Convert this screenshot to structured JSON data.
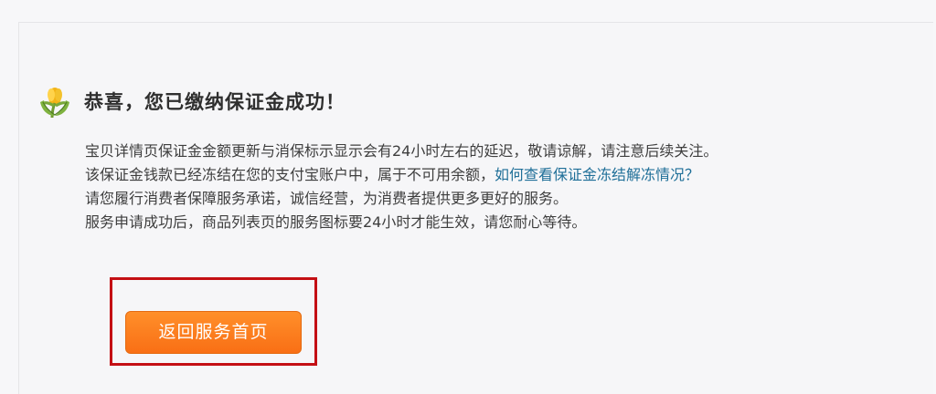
{
  "success": {
    "title": "恭喜，您已缴纳保证金成功！",
    "lines": {
      "line1": "宝贝详情页保证金金额更新与消保标示显示会有24小时左右的延迟，敬请谅解，请注意后续关注。",
      "line2_prefix": "该保证金钱款已经冻结在您的支付宝账户中，属于不可用余额，",
      "line2_link": "如何查看保证金冻结解冻情况？",
      "line3": "请您履行消费者保障服务承诺，诚信经营，为消费者提供更多更好的服务。",
      "line4": "服务申请成功后，商品列表页的服务图标要24小时才能生效，请您耐心等待。"
    }
  },
  "actions": {
    "return_button": "返回服务首页"
  },
  "colors": {
    "link": "#1f6f98",
    "button": "#f97616",
    "highlight": "#c40f14"
  },
  "icons": {
    "success_icon": "hands-holding-flower-icon"
  }
}
